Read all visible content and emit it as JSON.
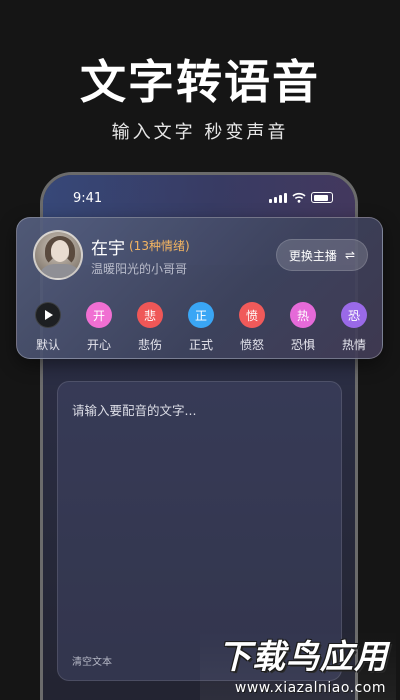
{
  "hero": {
    "title": "文字转语音",
    "subtitle": "输入文字  秒变声音"
  },
  "status_bar": {
    "time": "9:41",
    "icons": [
      "signal-icon",
      "wifi-icon",
      "battery-icon"
    ]
  },
  "voice": {
    "name": "在宇",
    "tag": "(13种情绪)",
    "description": "温暖阳光的小哥哥",
    "switch_label": "更换主播",
    "switch_icon": "⇌"
  },
  "emotions": [
    {
      "glyph": "",
      "label": "默认",
      "color": "#1d1f22",
      "icon": "play-icon"
    },
    {
      "glyph": "开",
      "label": "开心",
      "color": "#f06fd2"
    },
    {
      "glyph": "悲",
      "label": "悲伤",
      "color": "#ef5757"
    },
    {
      "glyph": "正",
      "label": "正式",
      "color": "#3aa6f5"
    },
    {
      "glyph": "愤",
      "label": "愤怒",
      "color": "#f05a5a"
    },
    {
      "glyph": "热",
      "label": "恐惧",
      "color": "#e56ad8"
    },
    {
      "glyph": "恐",
      "label": "热情",
      "color": "#9a6ae8"
    }
  ],
  "editor": {
    "placeholder": "请输入要配音的文字...",
    "clear_label": "清空文本"
  },
  "watermark": {
    "main": "下载鸟应用",
    "sub": "www.xiazalniao.com"
  },
  "colors": {
    "background": "#151515",
    "tag_accent": "#f4b562"
  }
}
